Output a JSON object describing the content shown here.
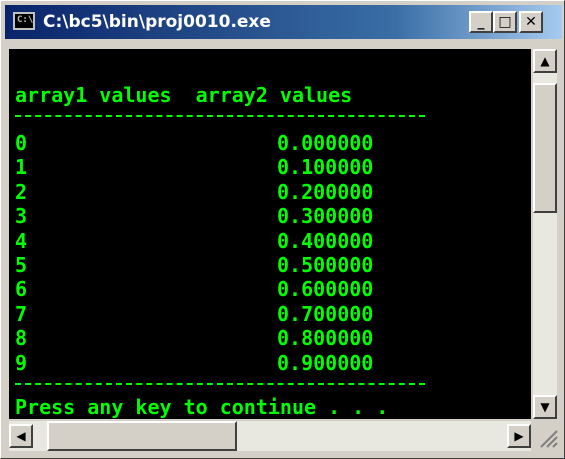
{
  "window": {
    "title": "C:\\bc5\\bin\\proj0010.exe",
    "icon_text": "C:\\",
    "minimize_glyph": "_",
    "maximize_glyph": "□",
    "close_glyph": "✕"
  },
  "console": {
    "header": "array1 values  array2 values",
    "separator": "-------------------------",
    "rows": [
      {
        "index": "0",
        "value": "0.000000"
      },
      {
        "index": "1",
        "value": "0.100000"
      },
      {
        "index": "2",
        "value": "0.200000"
      },
      {
        "index": "3",
        "value": "0.300000"
      },
      {
        "index": "4",
        "value": "0.400000"
      },
      {
        "index": "5",
        "value": "0.500000"
      },
      {
        "index": "6",
        "value": "0.600000"
      },
      {
        "index": "7",
        "value": "0.700000"
      },
      {
        "index": "8",
        "value": "0.800000"
      },
      {
        "index": "9",
        "value": "0.900000"
      }
    ],
    "footer": "Press any key to continue . . ."
  },
  "scrollbars": {
    "up_glyph": "▲",
    "down_glyph": "▼",
    "left_glyph": "◀",
    "right_glyph": "▶"
  },
  "colors": {
    "console_bg": "#000000",
    "console_text": "#00ff00",
    "title_active": "#0a246a"
  }
}
